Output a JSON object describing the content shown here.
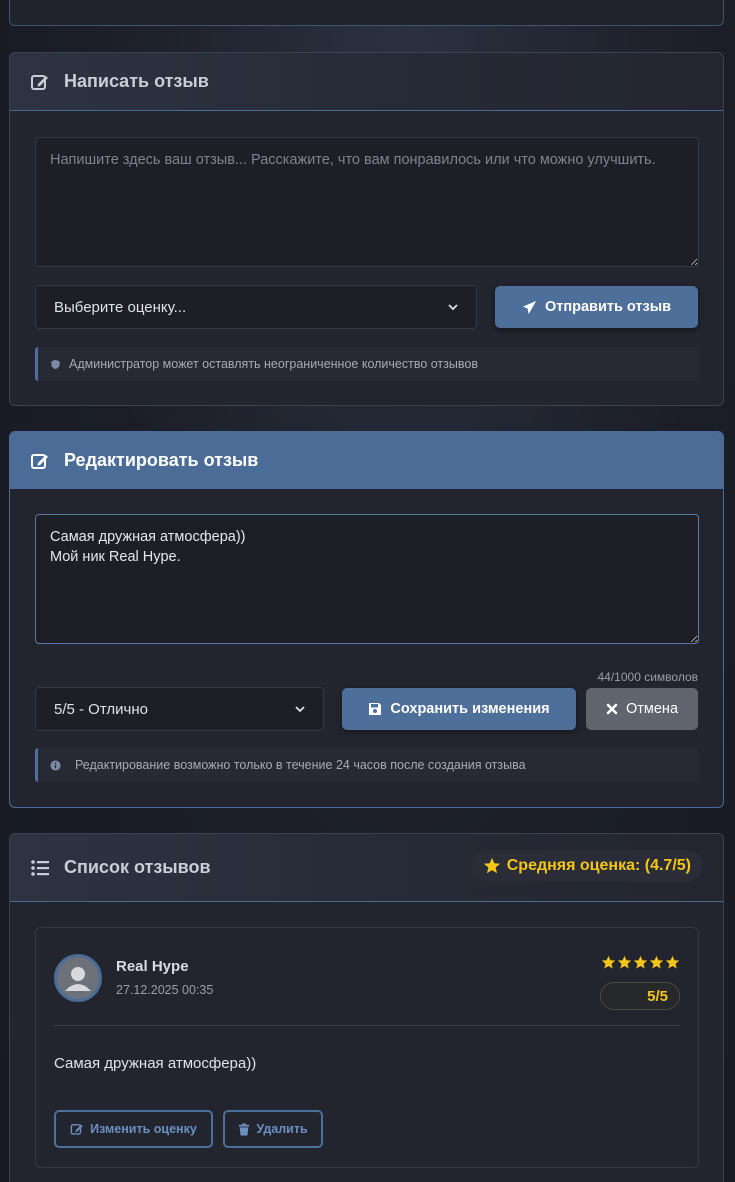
{
  "write_review": {
    "title": "Написать отзыв",
    "placeholder": "Напишите здесь ваш отзыв... Расскажите, что вам понравилось или что можно улучшить.",
    "rating_select": "Выберите оценку...",
    "submit_label": "Отправить отзыв",
    "admin_note": "Администратор может оставлять неограниченное количество отзывов"
  },
  "edit_review": {
    "title": "Редактировать отзыв",
    "text": "Самая дружная атмосфера))\nМой ник Real Hype.",
    "counter": "44/1000 символов",
    "rating_select": "5/5 - Отлично",
    "save_label": "Сохранить изменения",
    "cancel_label": "Отмена",
    "info_note": "Редактирование возможно только в течение 24 часов после создания отзыва"
  },
  "reviews_list": {
    "title": "Список отзывов",
    "average_label": "Средняя оценка: (4.7/5)",
    "items": [
      {
        "author": "Real Hype",
        "date": "27.12.2025 00:35",
        "stars": 5,
        "score": "5/5",
        "text": "Самая дружная атмосфера))",
        "edit_rating_label": "Изменить оценку",
        "delete_label": "Удалить"
      }
    ]
  },
  "colors": {
    "accent": "#4e6f9a",
    "star": "#f5c518",
    "card_bg": "#22242e"
  },
  "icons": [
    "edit-icon",
    "paper-plane-icon",
    "shield-icon",
    "save-icon",
    "close-icon",
    "info-icon",
    "list-icon",
    "star-icon",
    "trash-icon",
    "user-icon"
  ]
}
